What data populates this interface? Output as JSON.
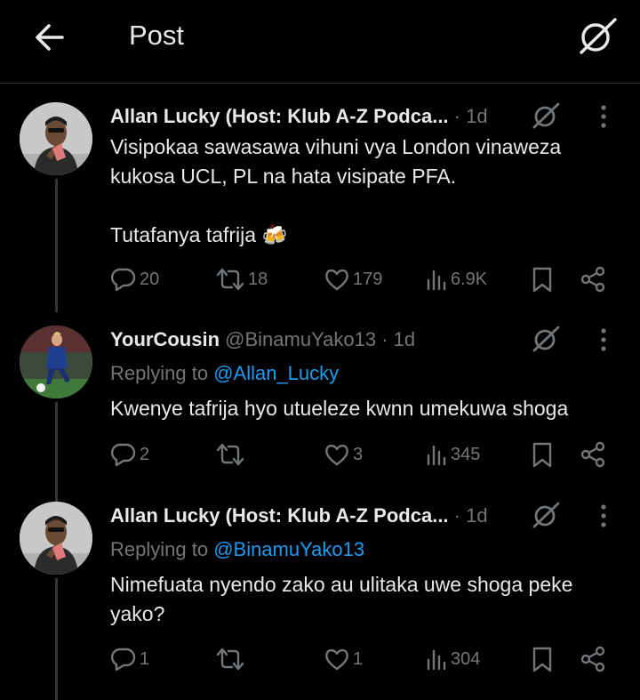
{
  "header": {
    "title": "Post"
  },
  "tweets": [
    {
      "name": "Allan Lucky (Host: Klub A-Z Podca...",
      "handle": "",
      "time": "1d",
      "reply_prefix": "",
      "reply_to": "",
      "text_lines": [
        "Visipokaa sawasawa vihuni vya London vinaweza",
        "kukosa UCL, PL na hata visipate PFA.",
        "",
        "Tutafanya tafrija 🍻"
      ],
      "replies": "20",
      "reposts": "18",
      "likes": "179",
      "views": "6.9K"
    },
    {
      "name": "YourCousin",
      "handle": "@BinamuYako13",
      "time": "1d",
      "reply_prefix": "Replying to ",
      "reply_to": "@Allan_Lucky",
      "text_lines": [
        "Kwenye tafrija hyo utueleze kwnn umekuwa shoga"
      ],
      "replies": "2",
      "reposts": "",
      "likes": "3",
      "views": "345"
    },
    {
      "name": "Allan Lucky (Host: Klub A-Z Podca...",
      "handle": "",
      "time": "1d",
      "reply_prefix": "Replying to ",
      "reply_to": "@BinamuYako13",
      "text_lines": [
        "Nimefuata nyendo zako au ulitaka uwe shoga peke",
        "yako?"
      ],
      "replies": "1",
      "reposts": "",
      "likes": "1",
      "views": "304"
    }
  ],
  "icons": {
    "back": "arrow-left-icon",
    "grok": "grok-icon",
    "more": "more-vertical-icon",
    "reply": "reply-icon",
    "repost": "repost-icon",
    "like": "heart-icon",
    "views": "views-icon",
    "bookmark": "bookmark-icon",
    "share": "share-icon"
  },
  "colors": {
    "background": "#000000",
    "text": "#e7e9ea",
    "muted": "#71767b",
    "link": "#1d9bf0",
    "divider": "#2f3336"
  }
}
